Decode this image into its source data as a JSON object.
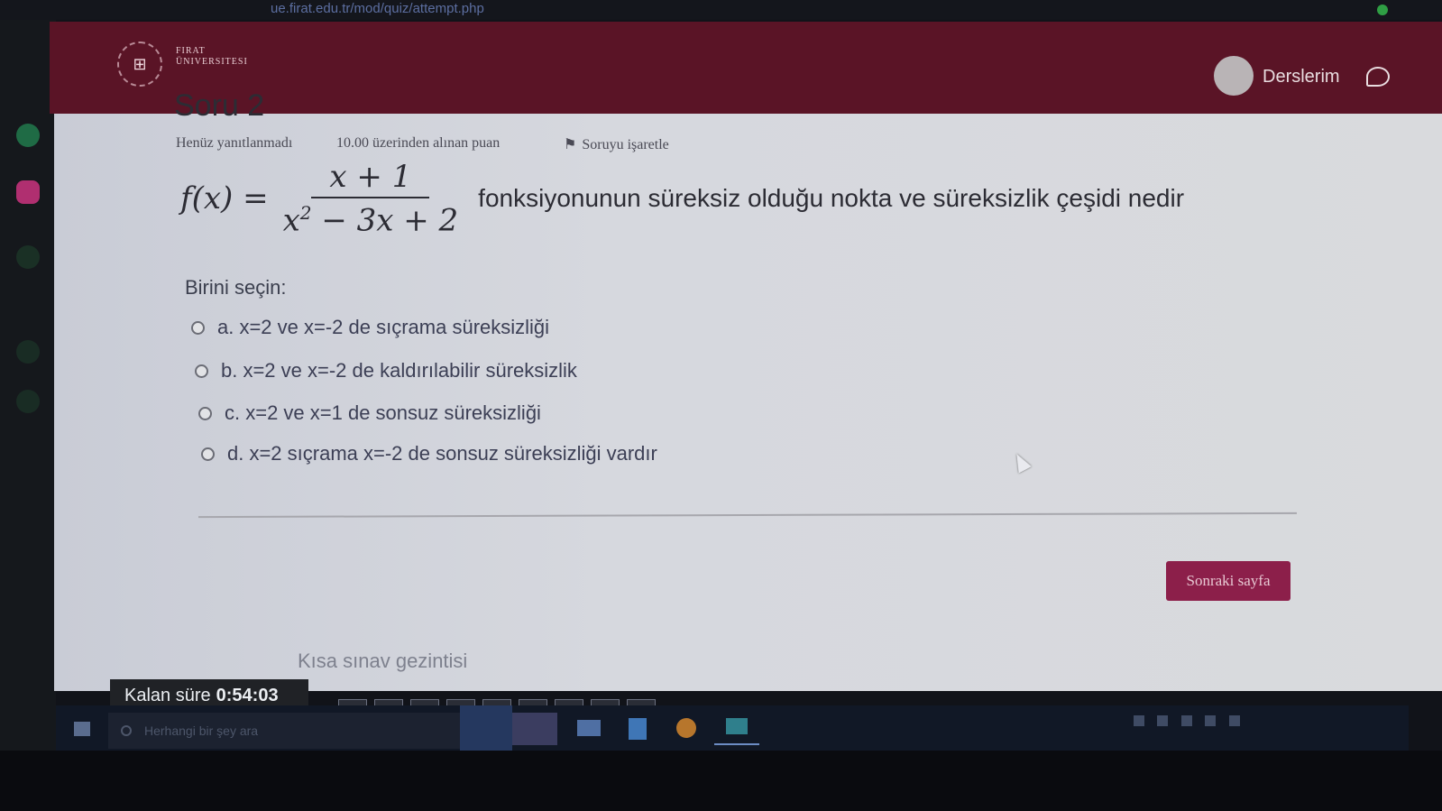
{
  "browser": {
    "url": "ue.firat.edu.tr/mod/quiz/attempt.php"
  },
  "header": {
    "logo_line1": "FIRAT",
    "logo_line2": "ÜNIVERSITESI",
    "nav_label": "Derslerim"
  },
  "question": {
    "title": "Soru 2",
    "status": "Henüz yanıtlanmadı",
    "grade": "10.00 üzerinden alınan puan",
    "flag_label": "Soruyu işaretle",
    "formula_lhs": "f(x) =",
    "formula_numerator": "x + 1",
    "formula_denominator_base": "x",
    "formula_denominator_exp": "2",
    "formula_denominator_rest": "− 3x + 2",
    "text": "fonksiyonunun süreksiz olduğu nokta ve süreksizlik çeşidi nedir",
    "prompt": "Birini seçin:",
    "options": [
      {
        "label": "a. x=2 ve x=-2 de sıçrama süreksizliği"
      },
      {
        "label": "b. x=2 ve x=-2 de kaldırılabilir süreksizlik"
      },
      {
        "label": "c. x=2 ve x=1 de sonsuz süreksizliği"
      },
      {
        "label": "d. x=2 sıçrama x=-2 de sonsuz süreksizliği vardır"
      }
    ],
    "next_button": "Sonraki sayfa"
  },
  "navigation": {
    "title": "Kısa sınav gezintisi"
  },
  "timer": {
    "label": "Kalan süre",
    "value": "0:54:03"
  },
  "taskbar": {
    "search_placeholder": "Herhangi bir şey ara"
  }
}
